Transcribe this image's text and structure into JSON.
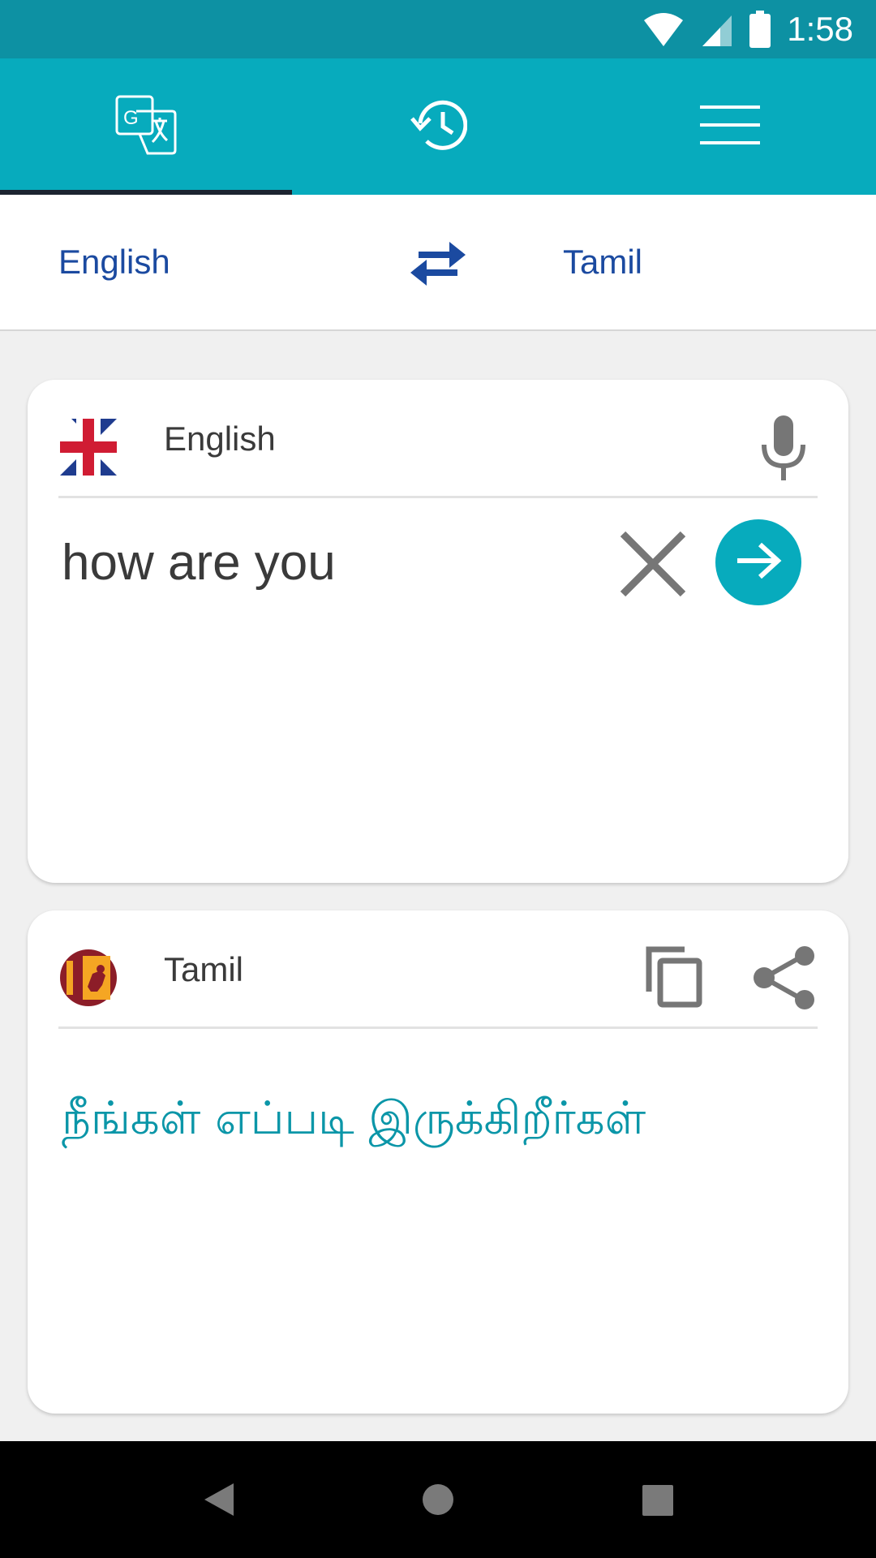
{
  "status_bar": {
    "time": "1:58",
    "icons": [
      "wifi-icon",
      "cell-signal-icon",
      "battery-icon"
    ]
  },
  "toolbar": {
    "tabs": [
      {
        "icon": "translate-icon",
        "active": true
      },
      {
        "icon": "history-icon",
        "active": false
      },
      {
        "icon": "menu-icon",
        "active": false
      }
    ]
  },
  "language_bar": {
    "source": "English",
    "target": "Tamil",
    "swap_icon": "swap-arrows-icon"
  },
  "input_card": {
    "language": "English",
    "flag": "uk-flag-icon",
    "text": "how are you",
    "icons": [
      "mic-icon",
      "clear-icon",
      "arrow-right-icon"
    ]
  },
  "output_card": {
    "language": "Tamil",
    "flag": "sri-lanka-flag-icon",
    "text": "நீங்கள் எப்படி இருக்கிறீர்கள்",
    "icons": [
      "copy-icon",
      "share-icon"
    ]
  },
  "colors": {
    "status_bar": "#0d91a3",
    "toolbar": "#07abbd",
    "language_text": "#1b4aa0",
    "output_text": "#0b96a8"
  }
}
